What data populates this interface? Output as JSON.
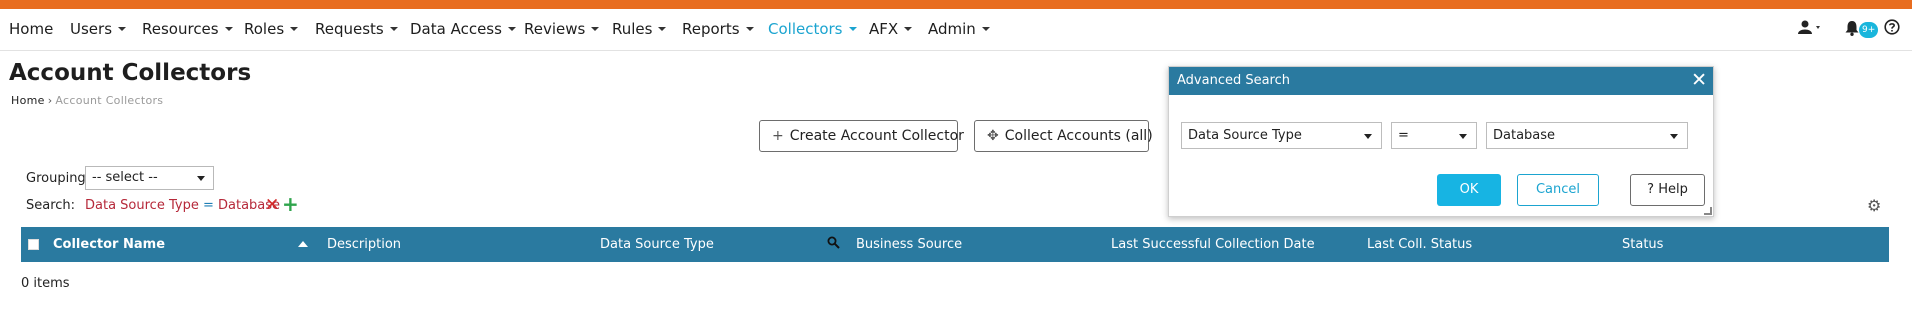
{
  "colors": {
    "brand_orange": "#e86d1f",
    "header_blue": "#2a7aa0",
    "active_link": "#1ba4d0",
    "ok_button": "#17b4e3",
    "filter_red": "#b6293a"
  },
  "nav": {
    "items": [
      {
        "label": "Home",
        "dropdown": false
      },
      {
        "label": "Users",
        "dropdown": true
      },
      {
        "label": "Resources",
        "dropdown": true
      },
      {
        "label": "Roles",
        "dropdown": true
      },
      {
        "label": "Requests",
        "dropdown": true
      },
      {
        "label": "Data Access",
        "dropdown": true
      },
      {
        "label": "Reviews",
        "dropdown": true
      },
      {
        "label": "Rules",
        "dropdown": true
      },
      {
        "label": "Reports",
        "dropdown": true
      },
      {
        "label": "Collectors",
        "dropdown": true,
        "active": true
      },
      {
        "label": "AFX",
        "dropdown": true
      },
      {
        "label": "Admin",
        "dropdown": true
      }
    ],
    "notification_count": "9+",
    "icons": [
      "user-icon",
      "bell-icon",
      "help-circle-icon"
    ]
  },
  "page": {
    "title": "Account Collectors",
    "breadcrumb": {
      "home": "Home",
      "separator": "›",
      "current": "Account Collectors"
    }
  },
  "actions": {
    "create_label": "Create Account Collector",
    "collect_label": "Collect Accounts (all)"
  },
  "grouping": {
    "label": "Grouping:",
    "value": "-- select --"
  },
  "search": {
    "label": "Search:",
    "filter_field": "Data Source Type",
    "filter_op": "=",
    "filter_value": "Database"
  },
  "table": {
    "columns": [
      "Collector Name",
      "Description",
      "Data Source Type",
      "Business Source",
      "Last Successful Collection Date",
      "Last Coll. Status",
      "Status"
    ],
    "sorted_column": "Collector Name",
    "sort_direction": "ascending",
    "rows": [],
    "items_count": "0 items"
  },
  "dialog": {
    "title": "Advanced Search",
    "field": "Data Source Type",
    "operator": "=",
    "value": "Database",
    "ok_label": "OK",
    "cancel_label": "Cancel",
    "help_label": "Help"
  }
}
